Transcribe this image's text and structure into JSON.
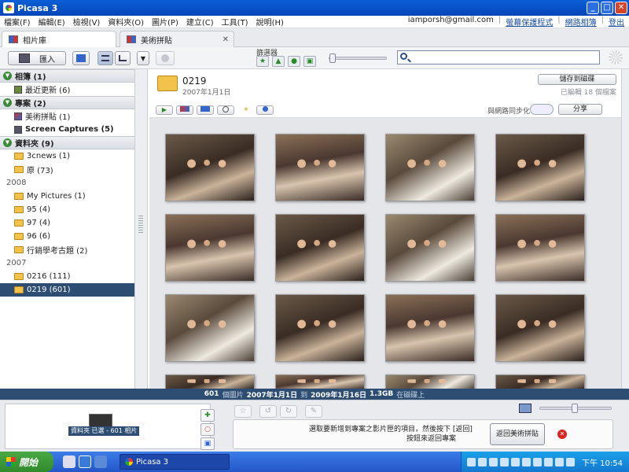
{
  "window": {
    "title": "Picasa 3",
    "min": "_",
    "max": "□",
    "close": "✕"
  },
  "menu": {
    "items": [
      "檔案(F)",
      "編輯(E)",
      "檢視(V)",
      "資料夾(O)",
      "圖片(P)",
      "建立(C)",
      "工具(T)",
      "說明(H)"
    ],
    "email": "iamporsh@gmail.com",
    "links": [
      "螢幕保護程式",
      "網路相簿",
      "登出"
    ]
  },
  "tabs": {
    "library": "相片庫",
    "collage": "美術拼貼",
    "close": "✕"
  },
  "toolbar": {
    "import": "匯入",
    "filter_label": "篩選器",
    "filter_icons": [
      "★",
      "▲",
      "●",
      "▣"
    ],
    "search_placeholder": ""
  },
  "left": {
    "sections": {
      "albums": "相簿 (1)",
      "projects": "專案 (2)",
      "folders": "資料夾 (9)"
    },
    "albums": [
      "最近更新 (6)"
    ],
    "projects": [
      "美術拼貼 (1)",
      "Screen Captures (5)"
    ],
    "folders_top": [
      "3cnews (1)",
      "原 (73)"
    ],
    "year2008": "2008",
    "folders_2008": [
      "My Pictures (1)",
      "95 (4)",
      "97 (4)",
      "96 (6)",
      "行銷學考古題 (2)"
    ],
    "year2007": "2007",
    "folders_2007": [
      "0216 (111)",
      "0219 (601)"
    ]
  },
  "folder": {
    "title": "0219",
    "date": "2007年1月1日",
    "save_button": "儲存到磁碟",
    "edited_note": "已編輯 18 個檔案",
    "sync_label": "與網路同步化",
    "share_button": "分享"
  },
  "status": {
    "count": "601",
    "count_unit": "個圖片",
    "from": "2007年1月1日",
    "to_label": "到",
    "to": "2009年1月16日",
    "size": "1.3GB",
    "size_unit": "在磁碟上"
  },
  "tray": {
    "selection_label": "資料夾 已選 - 601 相片",
    "message_line1": "選取要新增到專案之影片匣的項目，然後按下 [返回]",
    "message_line2": "按鈕來返回專案",
    "back_button": "返回美術拼貼",
    "cancel_icon": "✕"
  },
  "taskbar": {
    "start": "開始",
    "task_item": "Picasa 3",
    "clock": "下午 10:54"
  }
}
